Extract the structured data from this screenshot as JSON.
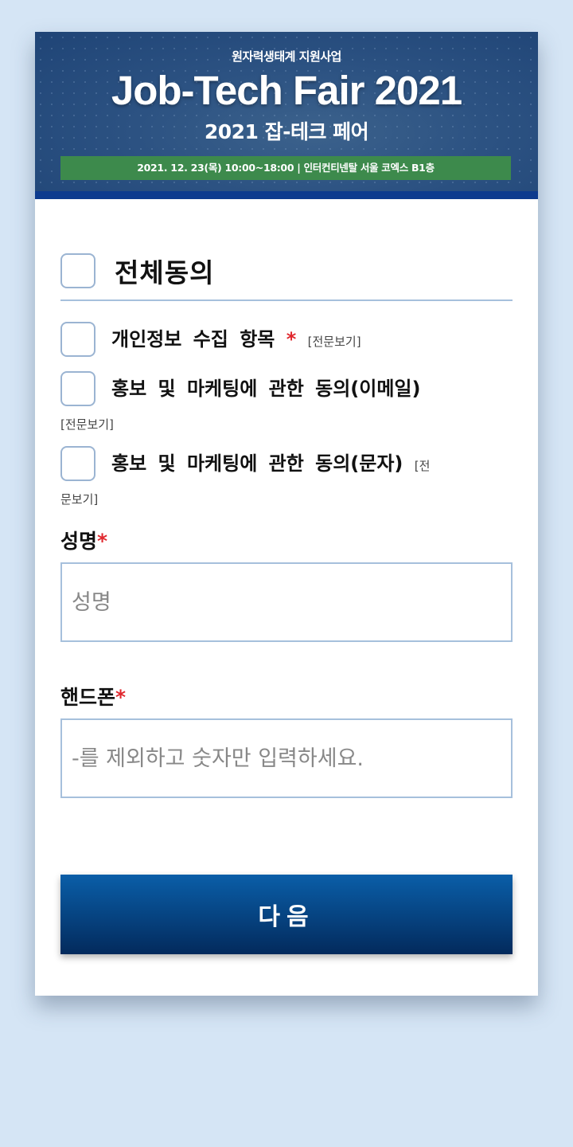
{
  "banner": {
    "subtitle": "원자력생태계 지원사업",
    "title": "Job-Tech Fair 2021",
    "korean_title": "2021 잡-테크 페어",
    "date_bar": "2021. 12. 23(목) 10:00~18:00  |  인터컨티넨탈 서울 코엑스 B1층"
  },
  "consent": {
    "all_label": "전체동의",
    "items": [
      {
        "label": "개인정보 수집 항목",
        "required": "*",
        "view": "[전문보기]"
      },
      {
        "label": "홍보 및 마케팅에 관한 동의(이메일)",
        "view": "[전문보기]"
      },
      {
        "label": "홍보 및 마케팅에 관한 동의(문자)",
        "view_part1": "[전",
        "view_part2": "문보기]"
      }
    ]
  },
  "form": {
    "name_label": "성명",
    "name_required": "*",
    "name_placeholder": "성명",
    "phone_label": "핸드폰",
    "phone_required": "*",
    "phone_placeholder": "-를 제외하고 숫자만 입력하세요."
  },
  "next_button": "다음",
  "colors": {
    "page_bg": "#d5e5f5",
    "accent": "#06427f",
    "required": "#e0282e",
    "banner_bar": "#3d8a4c"
  }
}
